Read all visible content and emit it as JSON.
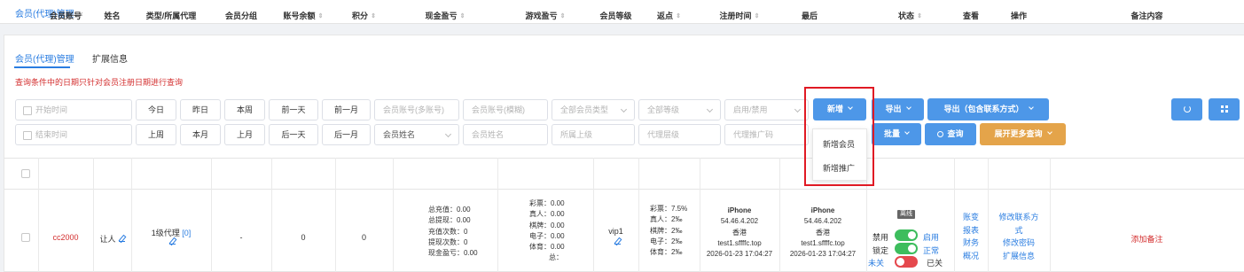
{
  "tab": {
    "label": "会员(代理)管理",
    "close": "×"
  },
  "subtabs": [
    "会员(代理)管理",
    "扩展信息"
  ],
  "note": "查询条件中的日期只针对会员注册日期进行查询",
  "filters": {
    "start_date": "开始时间",
    "end_date": "结束时间",
    "row1_dates": [
      "今日",
      "昨日",
      "本周",
      "前一天",
      "前一月"
    ],
    "row2_dates": [
      "上周",
      "本月",
      "上月",
      "后一天",
      "后一月"
    ],
    "multi_account": "会员账号(多账号)",
    "fuzzy_account": "会员账号(模糊)",
    "member_type": "全部会员类型",
    "all_levels": "全部等级",
    "enable_status": "启用/禁用",
    "name_field_select": "会员姓名",
    "member_name": "会员姓名",
    "parent": "所属上级",
    "agent_level": "代理层级",
    "promo_code": "代理推广码"
  },
  "actions": {
    "add": "新增",
    "export": "导出",
    "export_contact": "导出（包含联系方式）",
    "batch": "批量",
    "query": "查询",
    "more_query": "展开更多查询"
  },
  "dropdown": [
    "新增会员",
    "新增推广"
  ],
  "columns": [
    "会员账号",
    "姓名",
    "类型/所属代理",
    "会员分组",
    "账号余额",
    "积分",
    "现金盈亏",
    "游戏盈亏",
    "会员等级",
    "返点",
    "注册时间",
    "最后",
    "状态",
    "查看",
    "操作",
    "备注内容"
  ],
  "row": {
    "account": "cc2000",
    "name": "让人",
    "type": "1级代理",
    "type_count": "[0]",
    "group": "-",
    "balance": "0",
    "points": "0",
    "cash": [
      "总充值：0.00",
      "总提现：0.00",
      "充值次数：0",
      "提现次数：0",
      "现金盈亏：0.00"
    ],
    "game": [
      "彩票：0.00",
      "真人：0.00",
      "棋牌：0.00",
      "电子：0.00",
      "体育：0.00",
      "总："
    ],
    "level": "vip1",
    "rebate": [
      "彩票：7.5%",
      "真人：2‰",
      "棋牌：2‰",
      "电子：2‰",
      "体育：2‰"
    ],
    "reg": [
      "iPhone",
      "54.46.4.202",
      "香港",
      "test1.sffffc.top",
      "2026-01-23 17:04:27"
    ],
    "last": [
      "iPhone",
      "54.46.4.202",
      "香港",
      "test1.sffffc.top",
      "2026-01-23 17:04:27"
    ],
    "status": {
      "badge": "离线",
      "l1": "禁用",
      "r1": "启用",
      "l2": "锁定",
      "r2": "正常",
      "l3": "未关",
      "r3": "已关"
    },
    "view": [
      "账变",
      "报表",
      "财务",
      "概况"
    ],
    "ops": [
      "修改联系方",
      "式",
      "修改密码",
      "扩展信息"
    ],
    "remark": "添加备注"
  }
}
